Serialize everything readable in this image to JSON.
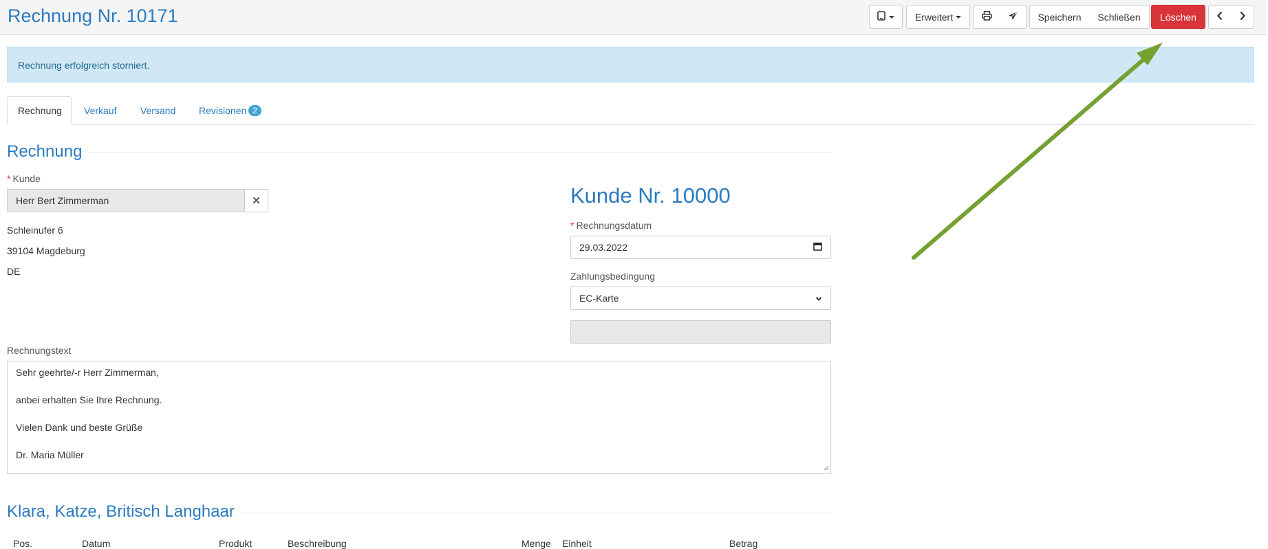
{
  "header": {
    "title": "Rechnung Nr. 10171",
    "buttons": {
      "device_icon": "tablet-icon",
      "erweitert": "Erweitert",
      "print_icon": "print-icon",
      "send_icon": "paper-plane-icon",
      "speichern": "Speichern",
      "schliessen": "Schließen",
      "loeschen": "Löschen",
      "prev_icon": "chevron-left-icon",
      "next_icon": "chevron-right-icon"
    }
  },
  "alert": {
    "message": "Rechnung erfolgreich storniert."
  },
  "tabs": [
    {
      "label": "Rechnung",
      "active": true
    },
    {
      "label": "Verkauf"
    },
    {
      "label": "Versand"
    },
    {
      "label": "Revisionen",
      "badge": "2"
    }
  ],
  "invoice": {
    "section_title": "Rechnung",
    "customer_label": "Kunde",
    "customer_value": "Herr Bert Zimmerman",
    "address": [
      "Schleinufer 6",
      "39104 Magdeburg",
      "DE"
    ],
    "customer_number": "Kunde Nr. 10000",
    "date_label": "Rechnungsdatum",
    "date_value": "29.03.2022",
    "payment_label": "Zahlungsbedingung",
    "payment_value": "EC-Karte",
    "text_label": "Rechnungstext",
    "text_lines": [
      "Sehr geehrte/-r Herr Zimmerman,",
      "anbei erhalten Sie Ihre Rechnung.",
      "Vielen Dank und beste Grüße",
      "Dr. Maria Müller"
    ]
  },
  "patient": {
    "section_title": "Klara, Katze, Britisch Langhaar",
    "columns": [
      "Pos.",
      "Datum",
      "Produkt",
      "Beschreibung",
      "Menge",
      "Einheit",
      "Betrag"
    ]
  },
  "colors": {
    "accent": "#2b7bc0",
    "danger": "#d9343a",
    "alert_bg": "#d0e8f5",
    "annotation_arrow": "#76a032"
  }
}
